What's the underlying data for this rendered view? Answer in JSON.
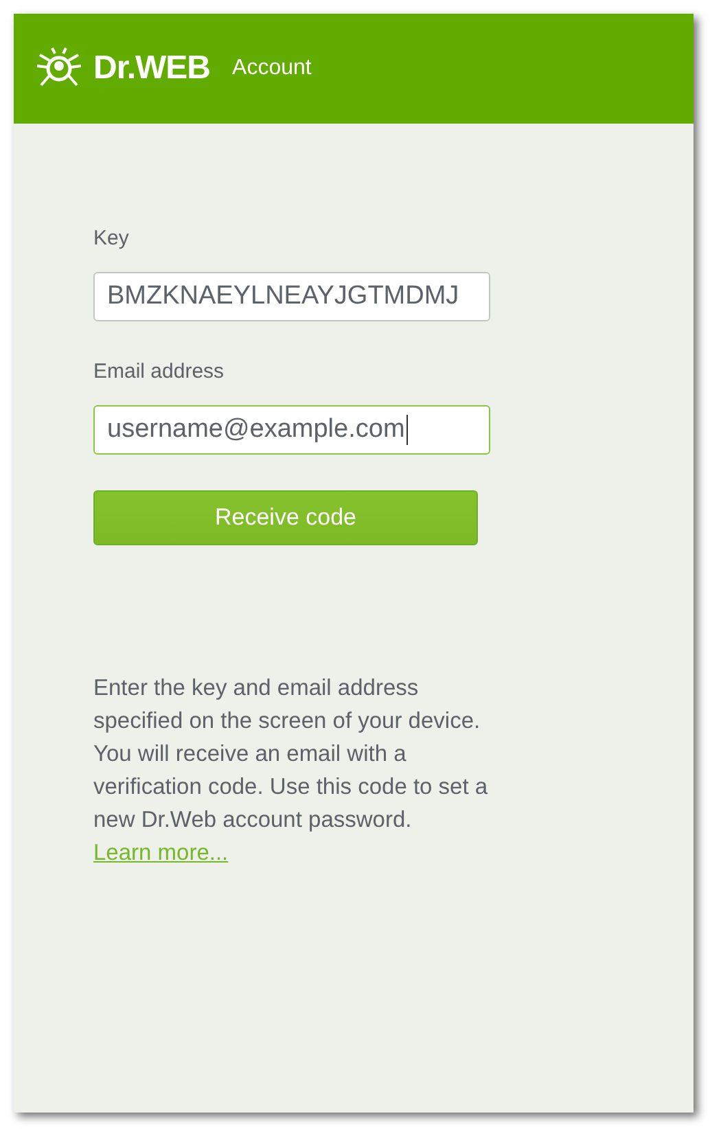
{
  "header": {
    "logo": "Dr.WEB",
    "title": "Account"
  },
  "fields": [
    {
      "label": "Key",
      "value": "BMZKNAEYLNEAYJGTMDMJ",
      "focused": false
    },
    {
      "label": "Email address",
      "value": "username@example.com",
      "focused": true
    }
  ],
  "button": "Receive code",
  "help": {
    "text": "Enter the key and email address specified on the screen of your device. You will receive an email with a verification code. Use this code to set a new Dr.Web account password. ",
    "link": "Learn more..."
  }
}
